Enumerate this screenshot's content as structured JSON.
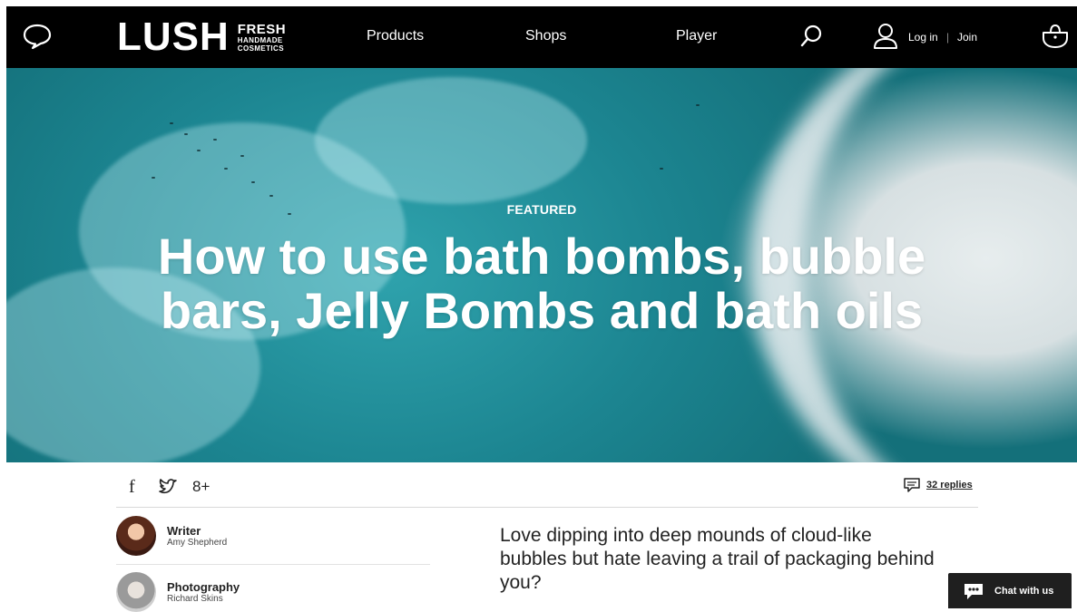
{
  "header": {
    "logo": {
      "word": "LUSH",
      "line1": "FRESH",
      "line2": "HANDMADE",
      "line3": "COSMETICS"
    },
    "nav": [
      {
        "label": "Products"
      },
      {
        "label": "Shops"
      },
      {
        "label": "Player"
      }
    ],
    "account": {
      "login": "Log in",
      "separator": "|",
      "join": "Join"
    },
    "icons": {
      "chat": "chat-bubble-icon",
      "search": "search-icon",
      "user": "user-icon",
      "basket": "basket-icon"
    }
  },
  "hero": {
    "kicker": "FEATURED",
    "title": "How to use bath bombs, bubble bars, Jelly Bombs and bath oils"
  },
  "share": {
    "icons": [
      "facebook-icon",
      "twitter-icon",
      "google-plus-icon"
    ],
    "facebook": "f",
    "google": "8+",
    "replies": "32 replies"
  },
  "credits": {
    "writer": {
      "role": "Writer",
      "name": "Amy Shepherd"
    },
    "photography": {
      "role": "Photography",
      "name": "Richard Skins"
    }
  },
  "article": {
    "intro": "Love dipping into deep mounds of cloud-like bubbles but hate leaving a trail of packaging behind you?"
  },
  "chat_widget": {
    "label": "Chat with us"
  },
  "colors": {
    "header_bg": "#000000",
    "hero_water": "#1a8e99",
    "chat_bg": "#1f1f1f"
  }
}
